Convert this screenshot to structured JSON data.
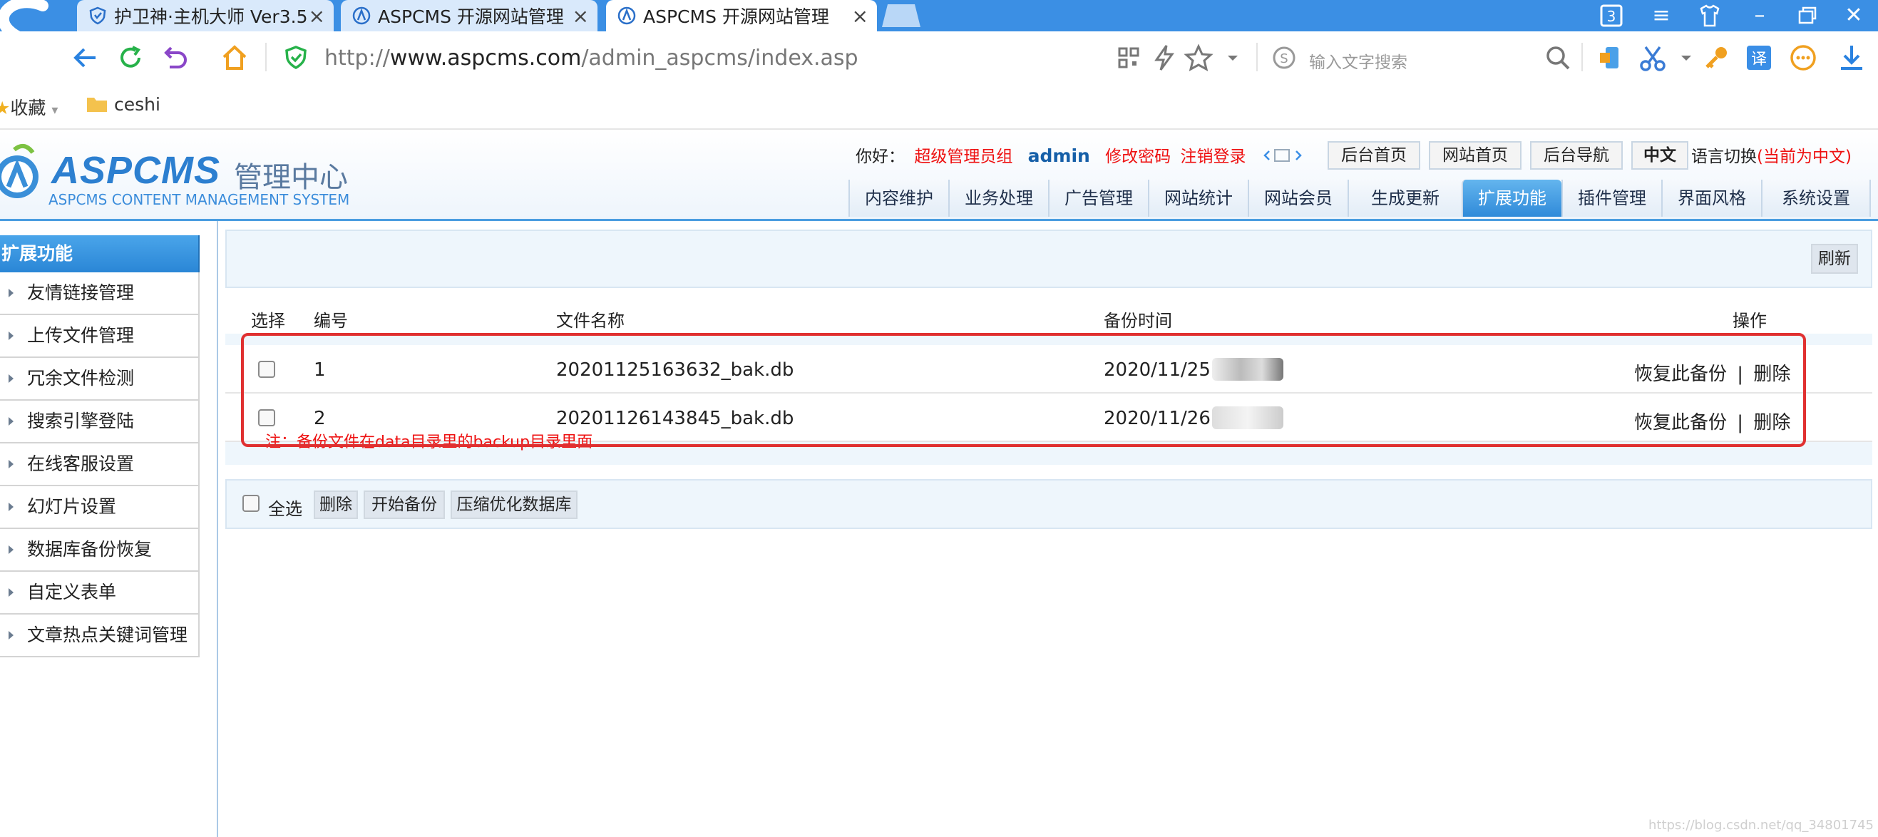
{
  "browser": {
    "tabs": [
      {
        "label": "护卫神·主机大师 Ver3.5",
        "active": false
      },
      {
        "label": "ASPCMS 开源网站管理",
        "active": false
      },
      {
        "label": "ASPCMS 开源网站管理",
        "active": true
      }
    ],
    "tab_count": "3",
    "url_prefix": "http://",
    "url_domain": "www.aspcms.com",
    "url_path": "/admin_aspcms/index.asp",
    "search_placeholder": "输入文字搜索",
    "bookmarks": [
      {
        "label": "收藏",
        "icon": "star-icon"
      },
      {
        "label": "ceshi",
        "icon": "folder-icon"
      }
    ]
  },
  "header": {
    "brand": "ASPCMS",
    "brand_cn": "管理中心",
    "brand_sub": "ASPCMS CONTENT MANAGEMENT SYSTEM",
    "greeting": "你好：",
    "role": "超级管理员组",
    "user": "admin",
    "change_pwd": "修改密码",
    "logout": "注销登录",
    "buttons": [
      "后台首页",
      "网站首页",
      "后台导航",
      "中文"
    ],
    "lang_switch": "语言切换",
    "lang_current": "(当前为中文)",
    "nav_tabs": [
      "内容维护",
      "业务处理",
      "广告管理",
      "网站统计",
      "网站会员",
      "生成更新",
      "扩展功能",
      "插件管理",
      "界面风格",
      "系统设置"
    ],
    "active_tab": "扩展功能"
  },
  "sidebar": {
    "title": "扩展功能",
    "items": [
      "友情链接管理",
      "上传文件管理",
      "冗余文件检测",
      "搜索引擎登陆",
      "在线客服设置",
      "幻灯片设置",
      "数据库备份恢复",
      "自定义表单",
      "文章热点关键词管理"
    ]
  },
  "main": {
    "refresh": "刷新",
    "columns": [
      "选择",
      "编号",
      "文件名称",
      "备份时间",
      "操作"
    ],
    "rows": [
      {
        "id": "1",
        "file": "20201125163632_bak.db",
        "time": "2020/11/25",
        "restore": "恢复此备份",
        "sep": "|",
        "delete": "删除"
      },
      {
        "id": "2",
        "file": "20201126143845_bak.db",
        "time": "2020/11/26",
        "restore": "恢复此备份",
        "sep": "|",
        "delete": "删除"
      }
    ],
    "note": "注：备份文件在data目录里的backup目录里面",
    "select_all": "全选",
    "actions": [
      "删除",
      "开始备份",
      "压缩优化数据库"
    ]
  },
  "watermark": "https://blog.csdn.net/qq_34801745",
  "colors": {
    "accent": "#3b8fe4",
    "active_tab": "#2f8ad9",
    "alert": "#e11111",
    "highlight_box": "#e03030"
  }
}
